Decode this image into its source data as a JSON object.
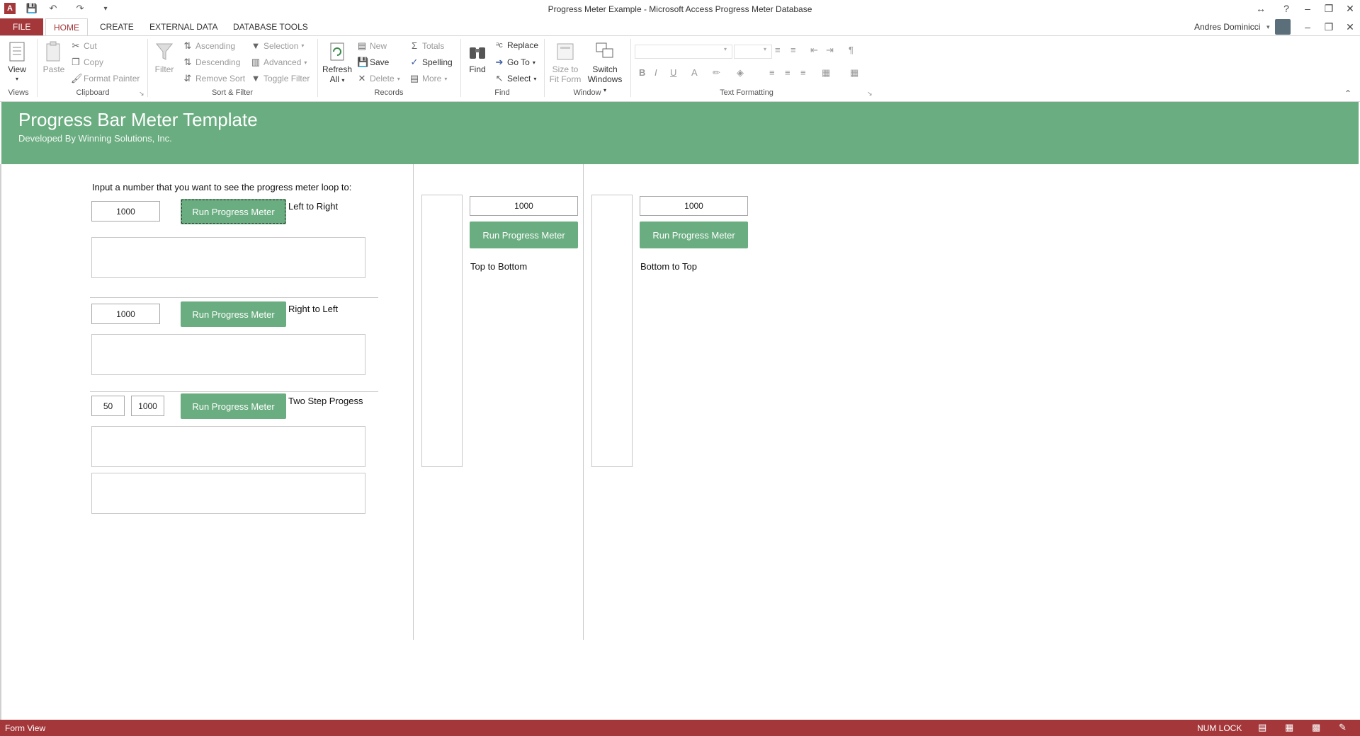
{
  "window": {
    "title": "Progress Meter Example - Microsoft Access Progress Meter Database",
    "user": "Andres Dominicci"
  },
  "tabs": [
    "FILE",
    "HOME",
    "CREATE",
    "EXTERNAL DATA",
    "DATABASE TOOLS"
  ],
  "ribbon": {
    "views": {
      "view": "View",
      "group": "Views"
    },
    "clipboard": {
      "paste": "Paste",
      "cut": "Cut",
      "copy": "Copy",
      "format_painter": "Format Painter",
      "group": "Clipboard"
    },
    "sort_filter": {
      "filter": "Filter",
      "ascending": "Ascending",
      "descending": "Descending",
      "remove_sort": "Remove Sort",
      "selection": "Selection",
      "advanced": "Advanced",
      "toggle_filter": "Toggle Filter",
      "group": "Sort & Filter"
    },
    "records": {
      "refresh": "Refresh",
      "refresh2": "All",
      "new": "New",
      "save": "Save",
      "delete": "Delete",
      "totals": "Totals",
      "spelling": "Spelling",
      "more": "More",
      "group": "Records"
    },
    "find": {
      "find": "Find",
      "replace": "Replace",
      "goto": "Go To",
      "select": "Select",
      "group": "Find"
    },
    "window": {
      "size_fit1": "Size to",
      "size_fit2": "Fit Form",
      "switch1": "Switch",
      "switch2": "Windows",
      "group": "Window"
    },
    "text_formatting": {
      "group": "Text Formatting",
      "bold": "B",
      "italic": "I",
      "underline": "U"
    }
  },
  "form": {
    "title": "Progress Bar Meter Template",
    "subtitle": "Developed By Winning Solutions, Inc.",
    "instruction": "Input a number that you want to see the progress meter loop to:",
    "run_label": "Run Progress Meter",
    "left_to_right": {
      "value": "1000",
      "label": "Left to Right"
    },
    "right_to_left": {
      "value": "1000",
      "label": "Right to Left"
    },
    "two_step": {
      "value1": "50",
      "value2": "1000",
      "label": "Two Step Progess"
    },
    "top_to_bottom": {
      "value": "1000",
      "label": "Top to Bottom"
    },
    "bottom_to_top": {
      "value": "1000",
      "label": "Bottom to Top"
    }
  },
  "status": {
    "view": "Form View",
    "numlock": "NUM LOCK"
  },
  "colors": {
    "accent_red": "#a4373a",
    "form_green": "#6aad80"
  }
}
